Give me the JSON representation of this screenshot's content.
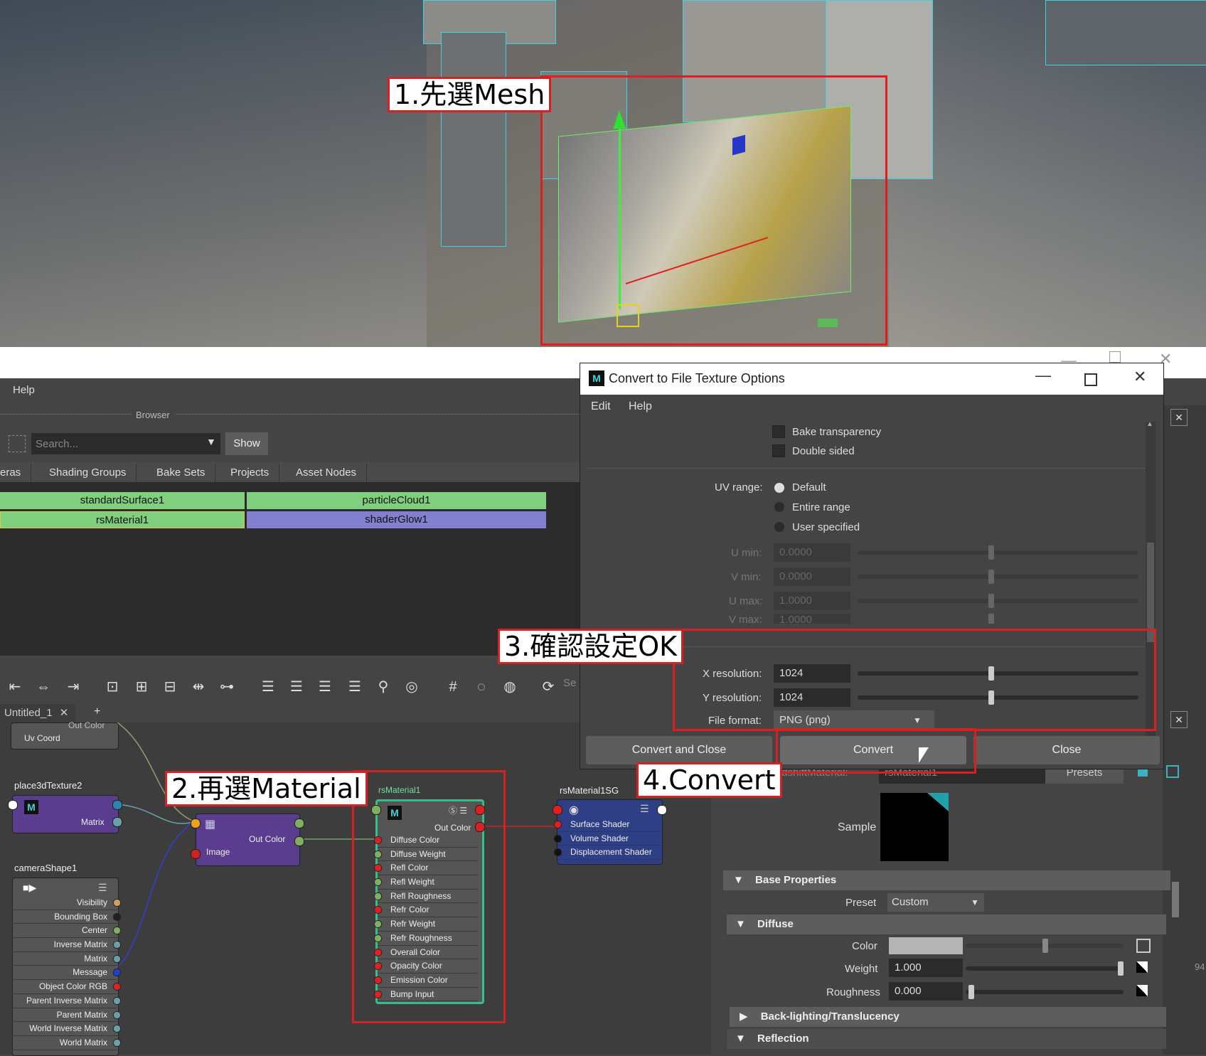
{
  "callouts": {
    "step1": "1.先選Mesh",
    "step2": "2.再選Material",
    "step3": "3.確認設定OK",
    "step4": "4.Convert"
  },
  "hypershade": {
    "menu_help": "Help",
    "browser_label": "Browser",
    "search_placeholder": "Search...",
    "show_button": "Show",
    "tabs": [
      "eras",
      "Shading Groups",
      "Bake Sets",
      "Projects",
      "Asset Nodes"
    ],
    "swatches": [
      "standardSurface1",
      "particleCloud1",
      "rsMaterial1",
      "shaderGlow1"
    ],
    "graph_tab": "Untitled_1",
    "graph_tab_add": "+",
    "search_partial": "Se"
  },
  "nodes": {
    "top_partial": {
      "label1": "Out Color",
      "label2": "Uv Coord"
    },
    "place3d": {
      "title": "place3dTexture2",
      "port": "Matrix"
    },
    "file": {
      "out": "Out Color",
      "in": "Image"
    },
    "camera": {
      "title": "cameraShape1",
      "attrs": [
        "Visibility",
        "Bounding Box",
        "Center",
        "Inverse Matrix",
        "Matrix",
        "Message",
        "Object Color RGB",
        "Parent Inverse Matrix",
        "Parent Matrix",
        "World Inverse Matrix",
        "World Matrix"
      ]
    },
    "rsmat": {
      "title": "rsMaterial1",
      "out": "Out Color",
      "attrs": [
        "Diffuse Color",
        "Diffuse Weight",
        "Refl Color",
        "Refl Weight",
        "Refl Roughness",
        "Refr Color",
        "Refr Weight",
        "Refr Roughness",
        "Overall Color",
        "Opacity Color",
        "Emission Color",
        "Bump Input"
      ]
    },
    "sg": {
      "title": "rsMaterial1SG",
      "attrs": [
        "Surface Shader",
        "Volume Shader",
        "Displacement Shader"
      ]
    }
  },
  "dialog": {
    "title": "Convert to File Texture Options",
    "menu": [
      "Edit",
      "Help"
    ],
    "bake_transparency": "Bake transparency",
    "double_sided": "Double sided",
    "uv_range_label": "UV range:",
    "uv_options": [
      "Default",
      "Entire range",
      "User specified"
    ],
    "u_min_label": "U min:",
    "u_min": "0.0000",
    "v_min_label": "V min:",
    "v_min": "0.0000",
    "u_max_label": "U max:",
    "u_max": "1.0000",
    "v_max_label": "V max:",
    "v_max": "1.0000",
    "x_res_label": "X resolution:",
    "x_res": "1024",
    "y_res_label": "Y resolution:",
    "y_res": "1024",
    "file_format_label": "File format:",
    "file_format": "PNG (png)",
    "buttons": {
      "convert_close": "Convert and Close",
      "convert": "Convert",
      "close": "Close"
    }
  },
  "attribute_editor": {
    "type_label": "RedshiftMaterial:",
    "type_value": "rsMaterial1",
    "presets": "Presets",
    "sample_label": "Sample",
    "base_properties": "Base Properties",
    "preset_label": "Preset",
    "preset_value": "Custom",
    "diffuse": "Diffuse",
    "color_label": "Color",
    "weight_label": "Weight",
    "weight": "1.000",
    "roughness_label": "Roughness",
    "roughness": "0.000",
    "backlighting": "Back-lighting/Translucency",
    "reflection": "Reflection",
    "edge_number": "94"
  },
  "colors": {
    "accent_red": "#d91f1f",
    "swatch_green": "#7fcf7f",
    "swatch_purple": "#8080cf",
    "node_purple": "#5a3d8e",
    "node_blue": "#2e3f85"
  }
}
